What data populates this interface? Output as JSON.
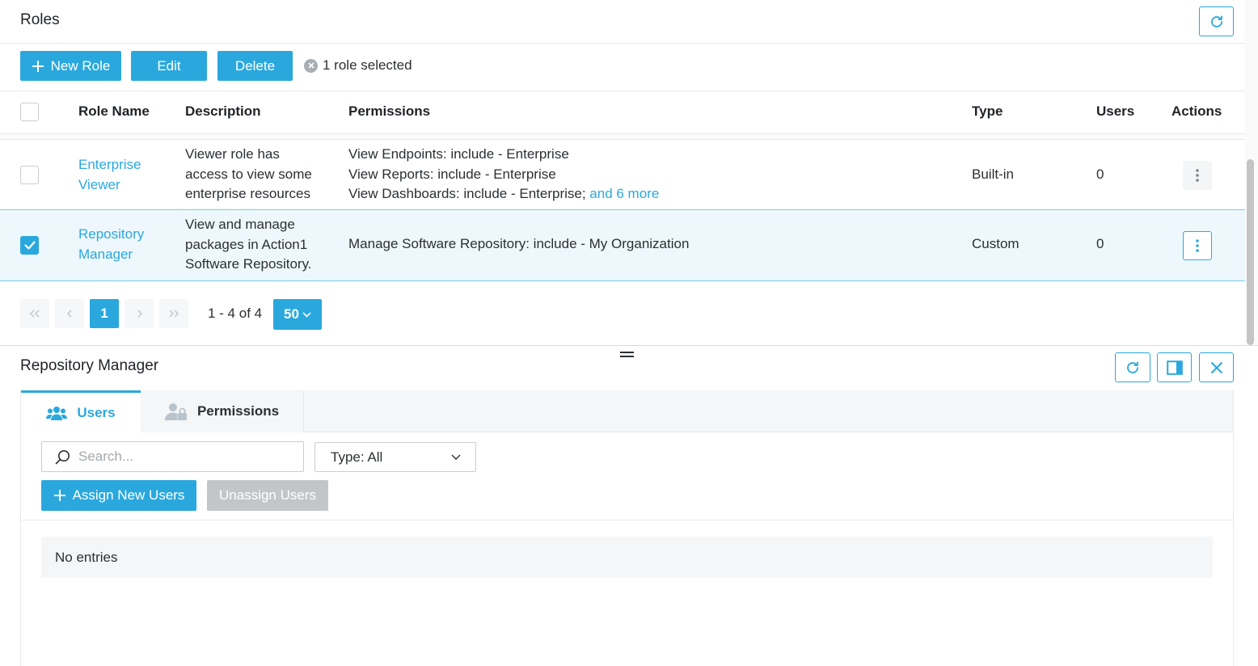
{
  "header": {
    "title": "Roles"
  },
  "toolbar": {
    "new_role": "New Role",
    "edit": "Edit",
    "delete": "Delete",
    "selection_text": "1 role selected"
  },
  "table": {
    "columns": [
      "Role Name",
      "Description",
      "Permissions",
      "Type",
      "Users",
      "Actions"
    ],
    "rows": [
      {
        "name_line1": "Enterprise",
        "name_line2": "Viewer",
        "desc_line1": "Viewer role has",
        "desc_line2": "access to view some",
        "desc_line3": "enterprise resources",
        "perm_line1": "View Endpoints: include - Enterprise",
        "perm_line2": "View Reports: include - Enterprise",
        "perm_line3": "View Dashboards: include - Enterprise;",
        "perm_more": "and 6 more",
        "type": "Built-in",
        "users": "0",
        "selected": false
      },
      {
        "name_line1": "Repository",
        "name_line2": "Manager",
        "desc_line1": "View and manage",
        "desc_line2": "packages in Action1",
        "desc_line3": "Software Repository.",
        "perm_line1": "Manage Software Repository: include - My Organization",
        "type": "Custom",
        "users": "0",
        "selected": true
      }
    ]
  },
  "pagination": {
    "current_page": "1",
    "range_text": "1 - 4 of 4",
    "page_size": "50"
  },
  "panel": {
    "title": "Repository Manager",
    "tabs": [
      {
        "label": "Users",
        "active": true
      },
      {
        "label": "Permissions",
        "active": false
      }
    ],
    "search_placeholder": "Search...",
    "type_filter": "Type: All",
    "assign_button": "Assign New Users",
    "unassign_button": "Unassign Users",
    "empty_text": "No entries"
  },
  "colors": {
    "accent": "#2aa8de",
    "disabled": "#c2c6c9",
    "selected_row": "#eef8fc"
  }
}
